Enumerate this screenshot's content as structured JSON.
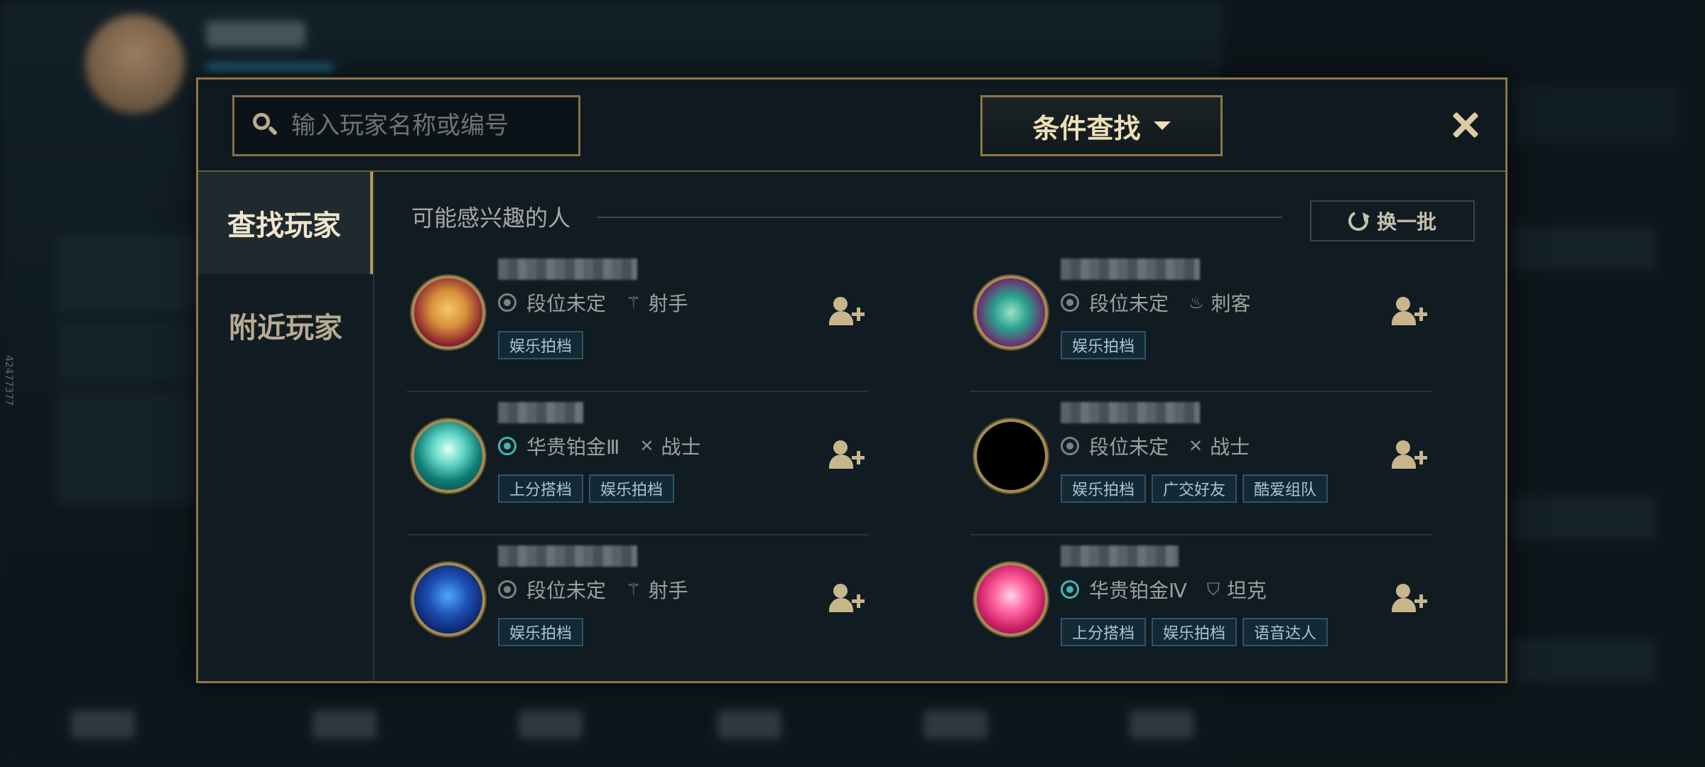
{
  "side_watermark": "42477377",
  "search": {
    "placeholder": "输入玩家名称或编号"
  },
  "filter_button": {
    "label": "条件查找"
  },
  "sidebar": {
    "tabs": [
      {
        "label": "查找玩家",
        "active": true
      },
      {
        "label": "附近玩家",
        "active": false
      }
    ]
  },
  "section": {
    "title": "可能感兴趣的人",
    "refresh_label": "换一批"
  },
  "players": [
    {
      "avatar": "av-1",
      "rank": "段位未定",
      "rank_icon": "unranked-icon",
      "role": "射手",
      "role_icon": "marksman-icon",
      "tags": [
        "娱乐拍档"
      ]
    },
    {
      "avatar": "av-2",
      "rank": "段位未定",
      "rank_icon": "unranked-icon",
      "role": "刺客",
      "role_icon": "assassin-icon",
      "tags": [
        "娱乐拍档"
      ]
    },
    {
      "avatar": "av-3",
      "rank": "华贵铂金Ⅲ",
      "rank_icon": "platinum-icon",
      "role": "战士",
      "role_icon": "fighter-icon",
      "tags": [
        "上分搭档",
        "娱乐拍档"
      ]
    },
    {
      "avatar": "av-4",
      "rank": "段位未定",
      "rank_icon": "unranked-icon",
      "role": "战士",
      "role_icon": "fighter-icon",
      "tags": [
        "娱乐拍档",
        "广交好友",
        "酷爱组队"
      ]
    },
    {
      "avatar": "av-5",
      "rank": "段位未定",
      "rank_icon": "unranked-icon",
      "role": "射手",
      "role_icon": "marksman-icon",
      "tags": [
        "娱乐拍档"
      ]
    },
    {
      "avatar": "av-6",
      "rank": "华贵铂金Ⅳ",
      "rank_icon": "platinum-icon",
      "role": "坦克",
      "role_icon": "tank-icon",
      "tags": [
        "上分搭档",
        "娱乐拍档",
        "语音达人"
      ]
    }
  ],
  "colors": {
    "gold_border": "#8c7646",
    "dialog_bg": "#101b22",
    "tag_bg": "#132a36",
    "accent_text": "#eedfb6"
  }
}
